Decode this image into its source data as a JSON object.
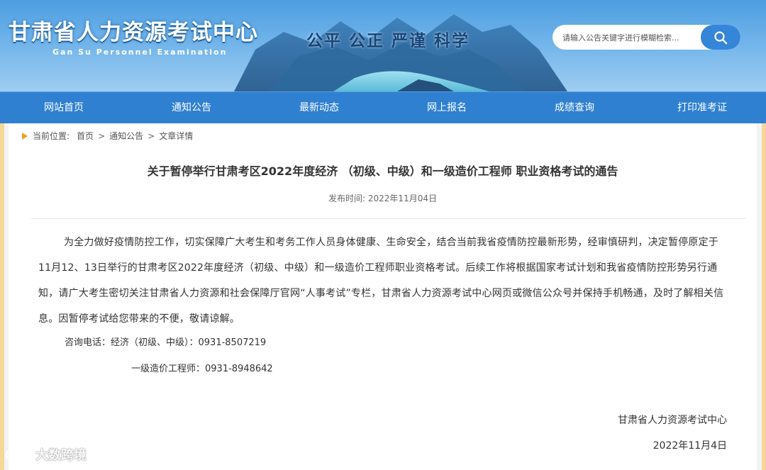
{
  "header": {
    "title": "甘肃省人力资源考试中心",
    "subtitle": "Gan Su Personnel Examination",
    "slogan": "公平 公正 严谨 科学",
    "search": {
      "placeholder": "请输入公告关键字进行模糊检索...",
      "icon": "search-icon"
    }
  },
  "nav": {
    "items": [
      {
        "label": "网站首页"
      },
      {
        "label": "通知公告"
      },
      {
        "label": "最新动态"
      },
      {
        "label": "网上报名"
      },
      {
        "label": "成绩查询"
      },
      {
        "label": "打印准考证"
      }
    ]
  },
  "breadcrumb": {
    "prefix": "当前位置:",
    "items": [
      "首页",
      "通知公告",
      "文章详情"
    ],
    "separator": ">"
  },
  "article": {
    "title": "关于暂停举行甘肃考区2022年度经济 （初级、中级）和一级造价工程师 职业资格考试的通告",
    "pubtime": "发布时间:  2022年11月04日",
    "paragraph": "为全力做好疫情防控工作，切实保障广大考生和考务工作人员身体健康、生命安全，结合当前我省疫情防控最新形势，经审慎研判，决定暂停原定于11月12、13日举行的甘肃考区2022年度经济（初级、中级）和一级造价工程师职业资格考试。后续工作将根据国家考试计划和我省疫情防控形势另行通知，请广大考生密切关注甘肃省人力资源和社会保障厅官网“人事考试”专栏，甘肃省人力资源考试中心网页或微信公众号并保持手机畅通，及时了解相关信息。因暂停考试给您带来的不便，敬请谅解。",
    "contact1": "咨询电话：经济（初级、中级）：0931-8507219",
    "contact2": "一级造价工程师：0931-8948642",
    "sign_org": "甘肃省人力资源考试中心",
    "sign_date": "2022年11月4日"
  },
  "watermark": {
    "text": "大数跨境"
  },
  "colors": {
    "nav_bg": "#2f80d1",
    "search_button": "#3585d9",
    "side_accent": "#f7c04a"
  }
}
